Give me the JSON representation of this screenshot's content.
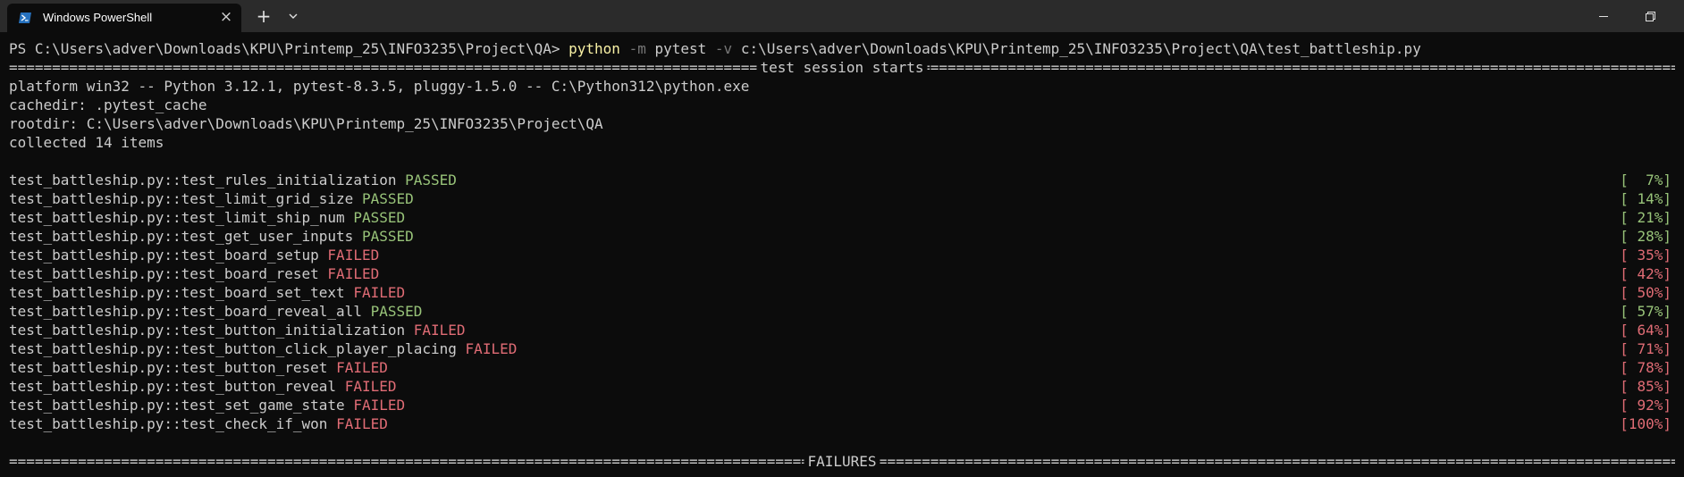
{
  "window": {
    "tab_title": "Windows PowerShell",
    "close_tab_glyph": "×",
    "new_tab_glyph": "+",
    "icons": [
      "powershell-icon",
      "close-icon",
      "plus-icon",
      "chevron-down-icon",
      "minimize-icon",
      "maximize-icon"
    ]
  },
  "colors": {
    "terminal_bg": "#0c0c0c",
    "text": "#cccccc",
    "command_highlight": "#f9f1a5",
    "flag_dim": "#767676",
    "passed": "#98c379",
    "failed": "#e06c75",
    "titlebar_bg": "#2b2b2b",
    "powershell_icon": "#2671be"
  },
  "prompt": {
    "text": "PS C:\\Users\\adver\\Downloads\\KPU\\Printemp_25\\INFO3235\\Project\\QA> ",
    "command": "python",
    "flag_m": "-m",
    "module": "pytest",
    "flag_v": "-v",
    "path": "c:\\Users\\adver\\Downloads\\KPU\\Printemp_25\\INFO3235\\Project\\QA\\test_battleship.py"
  },
  "session_header": "test session starts",
  "platform_line": "platform win32 -- Python 3.12.1, pytest-8.3.5, pluggy-1.5.0 -- C:\\Python312\\python.exe",
  "cachedir_line": "cachedir: .pytest_cache",
  "rootdir_line": "rootdir: C:\\Users\\adver\\Downloads\\KPU\\Printemp_25\\INFO3235\\Project\\QA",
  "collected_line": "collected 14 items",
  "tests": [
    {
      "name": "test_battleship.py::test_rules_initialization",
      "status": "PASSED",
      "percent": "[  7%]"
    },
    {
      "name": "test_battleship.py::test_limit_grid_size",
      "status": "PASSED",
      "percent": "[ 14%]"
    },
    {
      "name": "test_battleship.py::test_limit_ship_num",
      "status": "PASSED",
      "percent": "[ 21%]"
    },
    {
      "name": "test_battleship.py::test_get_user_inputs",
      "status": "PASSED",
      "percent": "[ 28%]"
    },
    {
      "name": "test_battleship.py::test_board_setup",
      "status": "FAILED",
      "percent": "[ 35%]"
    },
    {
      "name": "test_battleship.py::test_board_reset",
      "status": "FAILED",
      "percent": "[ 42%]"
    },
    {
      "name": "test_battleship.py::test_board_set_text",
      "status": "FAILED",
      "percent": "[ 50%]"
    },
    {
      "name": "test_battleship.py::test_board_reveal_all",
      "status": "PASSED",
      "percent": "[ 57%]"
    },
    {
      "name": "test_battleship.py::test_button_initialization",
      "status": "FAILED",
      "percent": "[ 64%]"
    },
    {
      "name": "test_battleship.py::test_button_click_player_placing",
      "status": "FAILED",
      "percent": "[ 71%]"
    },
    {
      "name": "test_battleship.py::test_button_reset",
      "status": "FAILED",
      "percent": "[ 78%]"
    },
    {
      "name": "test_battleship.py::test_button_reveal",
      "status": "FAILED",
      "percent": "[ 85%]"
    },
    {
      "name": "test_battleship.py::test_set_game_state",
      "status": "FAILED",
      "percent": "[ 92%]"
    },
    {
      "name": "test_battleship.py::test_check_if_won",
      "status": "FAILED",
      "percent": "[100%]"
    }
  ],
  "failures_header": "FAILURES"
}
